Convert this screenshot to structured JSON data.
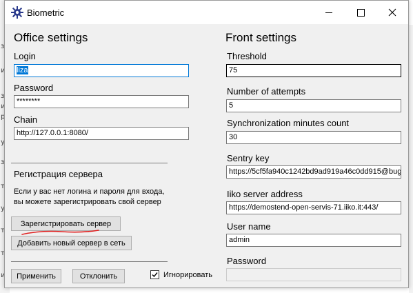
{
  "window": {
    "title": "Biometric",
    "icon": "gear-icon"
  },
  "office": {
    "heading": "Office settings",
    "login_label": "Login",
    "login_value": "liza",
    "password_label": "Password",
    "password_value": "********",
    "chain_label": "Chain",
    "chain_value": "http://127.0.0.1:8080/",
    "registration_heading": "Регистрация сервера",
    "registration_hint_line1": "Если у вас нет логина и пароля для входа,",
    "registration_hint_line2": "вы можете зарегистрировать свой сервер",
    "register_button": "Зарегистрировать сервер",
    "add_server_button": "Добавить новый сервер в сеть"
  },
  "front": {
    "heading": "Front settings",
    "threshold_label": "Threshold",
    "threshold_value": "75",
    "attempts_label": "Number of attempts",
    "attempts_value": "5",
    "sync_label": "Synchronization minutes count",
    "sync_value": "30",
    "sentry_label": "Sentry key",
    "sentry_value": "https://5cf5fa940c1242bd9ad919a46c0dd915@bug",
    "iiko_label": "Iiko server address",
    "iiko_value": "https://demostend-open-servis-71.iiko.it:443/",
    "username_label": "User name",
    "username_value": "admin",
    "password_label": "Password",
    "password_value": ""
  },
  "footer": {
    "apply_button": "Применить",
    "cancel_button": "Отклонить",
    "ignore_label": "Игнорировать",
    "ignore_checked": true
  },
  "background": {
    "edge_chars": [
      "з",
      "и",
      "з",
      "и",
      "р",
      "у",
      "з",
      "т",
      "у",
      "т",
      "т",
      "и"
    ]
  },
  "colors": {
    "accent": "#0078d7",
    "annotation": "#e02020"
  }
}
